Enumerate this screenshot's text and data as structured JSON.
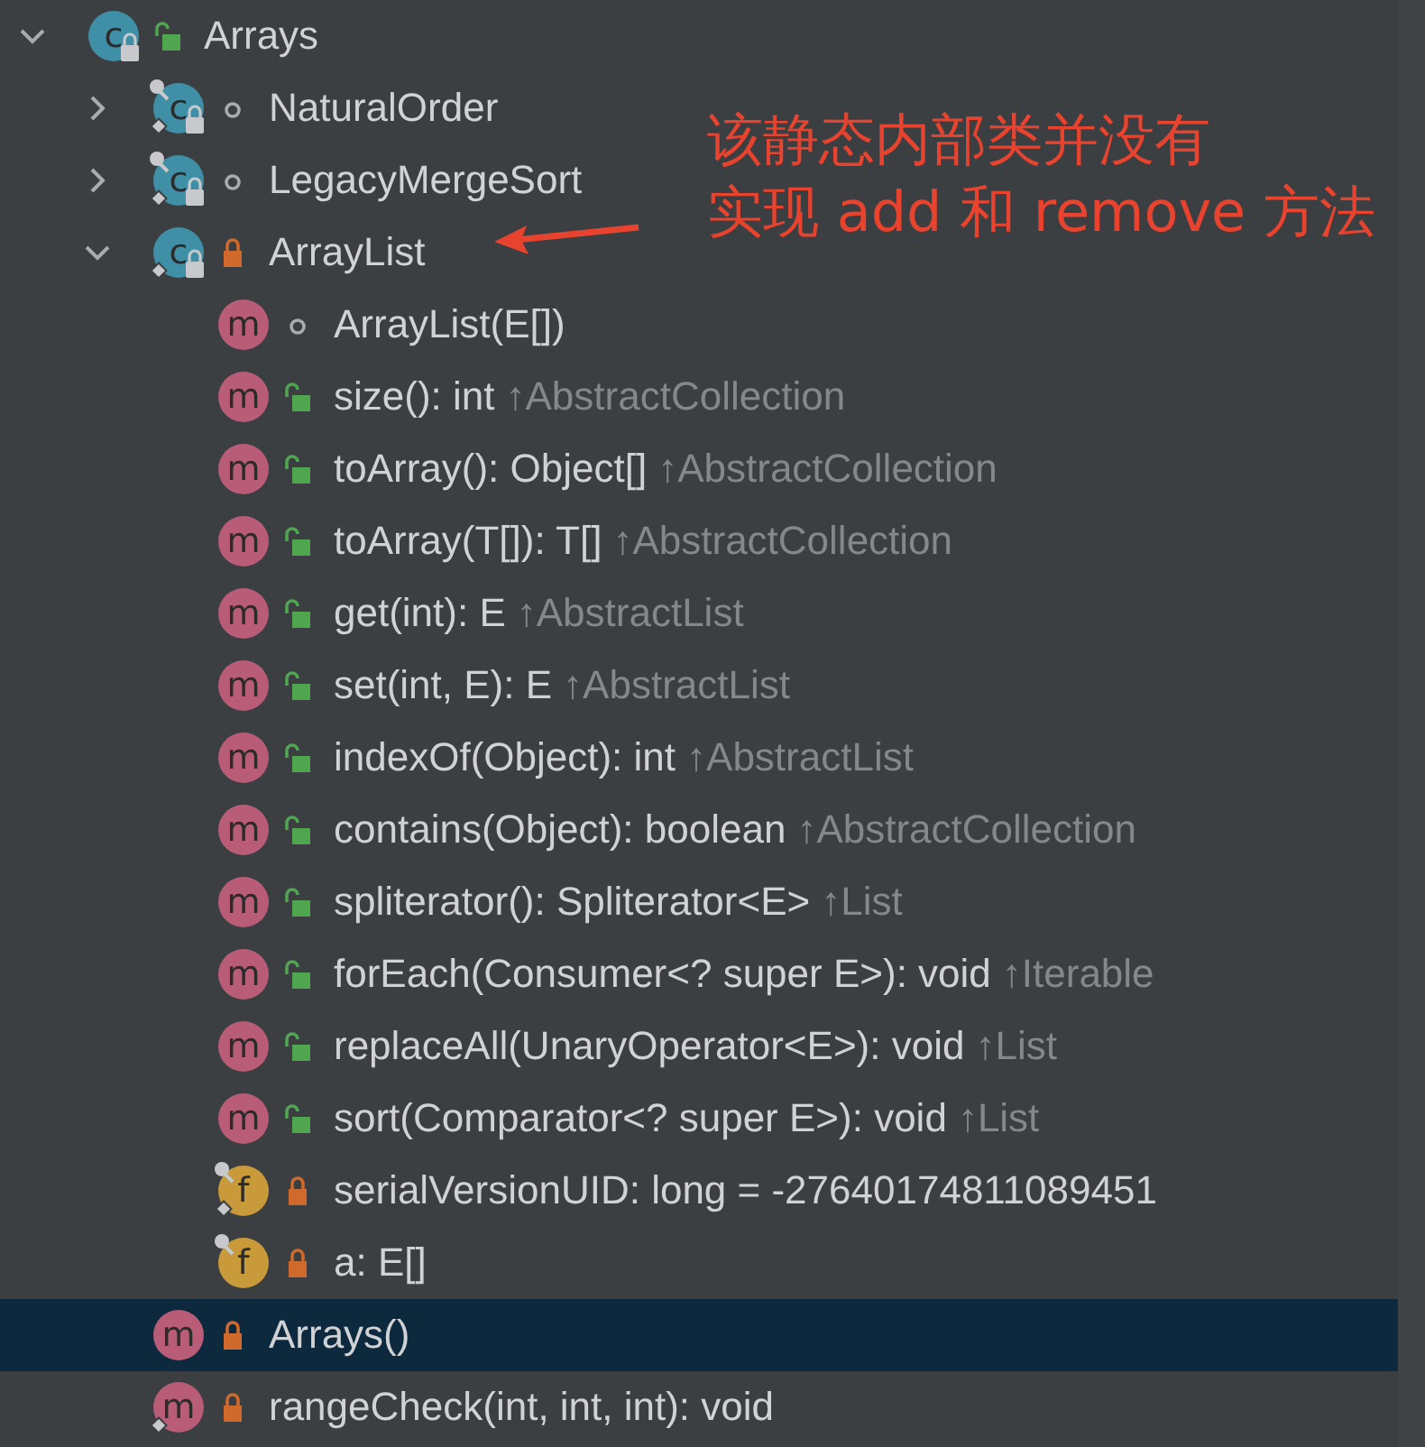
{
  "tree": [
    {
      "kind": "class",
      "icon_letter": "c",
      "public": true,
      "private": false,
      "name": "Arrays",
      "expanded": true,
      "static": false,
      "final": false,
      "selected": false,
      "children": [
        {
          "kind": "class",
          "icon_letter": "c",
          "public": false,
          "private": false,
          "name": "NaturalOrder",
          "expanded": false,
          "static": true,
          "final": true,
          "selected": false
        },
        {
          "kind": "class",
          "icon_letter": "c",
          "public": false,
          "private": false,
          "name": "LegacyMergeSort",
          "expanded": false,
          "static": true,
          "final": true,
          "selected": false
        },
        {
          "kind": "class",
          "icon_letter": "c",
          "public": false,
          "private": true,
          "name": "ArrayList",
          "expanded": true,
          "static": true,
          "final": false,
          "selected": false,
          "children": [
            {
              "kind": "method",
              "icon_letter": "m",
              "public": false,
              "private": false,
              "name": "ArrayList(E[])",
              "selected": false
            },
            {
              "kind": "method",
              "icon_letter": "m",
              "public": true,
              "private": false,
              "name": "size(): int",
              "inherited": "↑AbstractCollection",
              "selected": false
            },
            {
              "kind": "method",
              "icon_letter": "m",
              "public": true,
              "private": false,
              "name": "toArray(): Object[]",
              "inherited": "↑AbstractCollection",
              "selected": false
            },
            {
              "kind": "method",
              "icon_letter": "m",
              "public": true,
              "private": false,
              "name": "toArray(T[]): T[]",
              "inherited": "↑AbstractCollection",
              "selected": false
            },
            {
              "kind": "method",
              "icon_letter": "m",
              "public": true,
              "private": false,
              "name": "get(int): E",
              "inherited": "↑AbstractList",
              "selected": false
            },
            {
              "kind": "method",
              "icon_letter": "m",
              "public": true,
              "private": false,
              "name": "set(int, E): E",
              "inherited": "↑AbstractList",
              "selected": false
            },
            {
              "kind": "method",
              "icon_letter": "m",
              "public": true,
              "private": false,
              "name": "indexOf(Object): int",
              "inherited": "↑AbstractList",
              "selected": false
            },
            {
              "kind": "method",
              "icon_letter": "m",
              "public": true,
              "private": false,
              "name": "contains(Object): boolean",
              "inherited": "↑AbstractCollection",
              "selected": false
            },
            {
              "kind": "method",
              "icon_letter": "m",
              "public": true,
              "private": false,
              "name": "spliterator(): Spliterator<E>",
              "inherited": "↑List",
              "selected": false
            },
            {
              "kind": "method",
              "icon_letter": "m",
              "public": true,
              "private": false,
              "name": "forEach(Consumer<? super E>): void",
              "inherited": "↑Iterable",
              "selected": false
            },
            {
              "kind": "method",
              "icon_letter": "m",
              "public": true,
              "private": false,
              "name": "replaceAll(UnaryOperator<E>): void",
              "inherited": "↑List",
              "selected": false
            },
            {
              "kind": "method",
              "icon_letter": "m",
              "public": true,
              "private": false,
              "name": "sort(Comparator<? super E>): void",
              "inherited": "↑List",
              "selected": false
            },
            {
              "kind": "field",
              "icon_letter": "f",
              "public": false,
              "private": true,
              "name": "serialVersionUID: long = -27640174811089451",
              "static": true,
              "final": true,
              "selected": false
            },
            {
              "kind": "field",
              "icon_letter": "f",
              "public": false,
              "private": true,
              "name": "a: E[]",
              "static": false,
              "final": true,
              "selected": false
            }
          ]
        },
        {
          "kind": "method",
          "icon_letter": "m",
          "public": false,
          "private": true,
          "name": "Arrays()",
          "selected": true
        },
        {
          "kind": "method",
          "icon_letter": "m",
          "public": false,
          "private": true,
          "name": "rangeCheck(int, int, int): void",
          "static": true,
          "selected": false
        }
      ]
    }
  ],
  "annotation": {
    "lines": [
      "该静态内部类并没有",
      "实现 add 和 remove 方法"
    ]
  }
}
